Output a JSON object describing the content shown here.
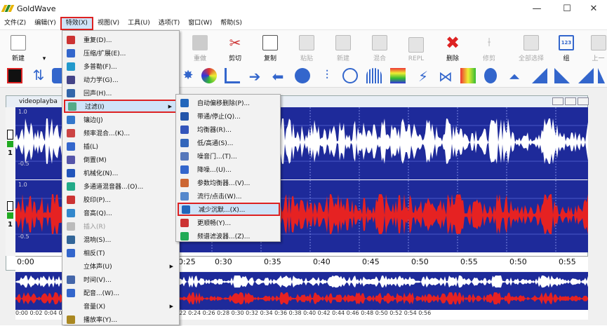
{
  "app": {
    "title": "GoldWave"
  },
  "window_controls": {
    "minimize": "—",
    "maximize": "☐",
    "close": "✕"
  },
  "menubar": [
    {
      "label": "文件(Z)"
    },
    {
      "label": "编辑(Y)"
    },
    {
      "label": "特效(X)"
    },
    {
      "label": "视图(V)"
    },
    {
      "label": "工具(U)"
    },
    {
      "label": "选项(T)"
    },
    {
      "label": "窗口(W)"
    },
    {
      "label": "帮助(S)"
    }
  ],
  "toolbar": {
    "new": "新建",
    "redo": "重做",
    "cut": "剪切",
    "copy": "复制",
    "paste": "粘贴",
    "paste_new": "新建",
    "mix": "混合",
    "repl": "REPL",
    "delete": "删除",
    "trim": "修剪",
    "select_all": "全部选择",
    "set": "组",
    "set_icon": "123",
    "prev": "上一"
  },
  "document": {
    "title": "videoplayba"
  },
  "waveform": {
    "top_channel": {
      "max": "1.0",
      "min": "-0.5"
    },
    "bottom_channel": {
      "max": "1.0",
      "min": "-0.5"
    },
    "channel_number": "1"
  },
  "timeline": [
    "0:00",
    "0:25",
    "0:30",
    "0:35",
    "0:40",
    "0:45",
    "0:50",
    "0:55"
  ],
  "overview_time": "0:00 0:02 0:04 0:06 0:08 0:10 0:12 0:14 0:16 0:18 0:20 0:22 0:24 0:26 0:28 0:30 0:32 0:34 0:36 0:38 0:40 0:42 0:44 0:46 0:48 0:50 0:52 0:54 0:56",
  "effects_menu": {
    "items": [
      {
        "label": "重复(D)...",
        "color": "#c33"
      },
      {
        "label": "压缩/扩展(E)...",
        "color": "#36c"
      },
      {
        "label": "多普勒(F)...",
        "color": "#29c"
      },
      {
        "label": "动力学(G)...",
        "color": "#448"
      },
      {
        "label": "回声(H)...",
        "color": "#36a"
      },
      {
        "label": "过滤(I)",
        "color": "#5a8",
        "submenu": true
      },
      {
        "label": "镶边(J)",
        "color": "#37c"
      },
      {
        "label": "频率混合...(K)...",
        "color": "#c44"
      },
      {
        "label": "插(L)",
        "color": "#36c"
      },
      {
        "label": "倒置(M)",
        "color": "#55a"
      },
      {
        "label": "机械化(N)...",
        "color": "#25b"
      },
      {
        "label": "多通道混音器...(O)...",
        "color": "#2a8"
      },
      {
        "label": "胶印(P)...",
        "color": "#c33"
      },
      {
        "label": "音高(Q)...",
        "color": "#38c"
      },
      {
        "label": "插入(R)",
        "color": "#bbb",
        "disabled": true
      },
      {
        "label": "混响(S)...",
        "color": "#369"
      },
      {
        "label": "相反(T)",
        "color": "#36c"
      },
      {
        "label": "立体声(U)",
        "color": "none",
        "submenu": true
      },
      {
        "label": "时间(V)...",
        "color": "#46a"
      },
      {
        "label": "配音...(W)...",
        "color": "#36c"
      },
      {
        "label": "音量(X)",
        "color": "none",
        "submenu": true
      },
      {
        "label": "播放率(Y)...",
        "color": "#a82"
      }
    ]
  },
  "filter_submenu": {
    "items": [
      {
        "label": "自动偏移删除(P)...",
        "color": "#26b"
      },
      {
        "label": "带通/停止(Q)...",
        "color": "#25a"
      },
      {
        "label": "均衡器(R)...",
        "color": "#35b"
      },
      {
        "label": "低/高通(S)...",
        "color": "#36b"
      },
      {
        "label": "噪音门...(T)...",
        "color": "#57b"
      },
      {
        "label": "降噪...(U)...",
        "color": "#36c"
      },
      {
        "label": "参数均衡器...(V)...",
        "color": "#c63"
      },
      {
        "label": "流行/点击(W)...",
        "color": "#58c"
      },
      {
        "label": "减少沉默...(X)...",
        "color": "#26b"
      },
      {
        "label": "更顺畅(Y)...",
        "color": "#c33"
      },
      {
        "label": "频谱滤波器...(Z)...",
        "color": "#2a5"
      }
    ]
  }
}
